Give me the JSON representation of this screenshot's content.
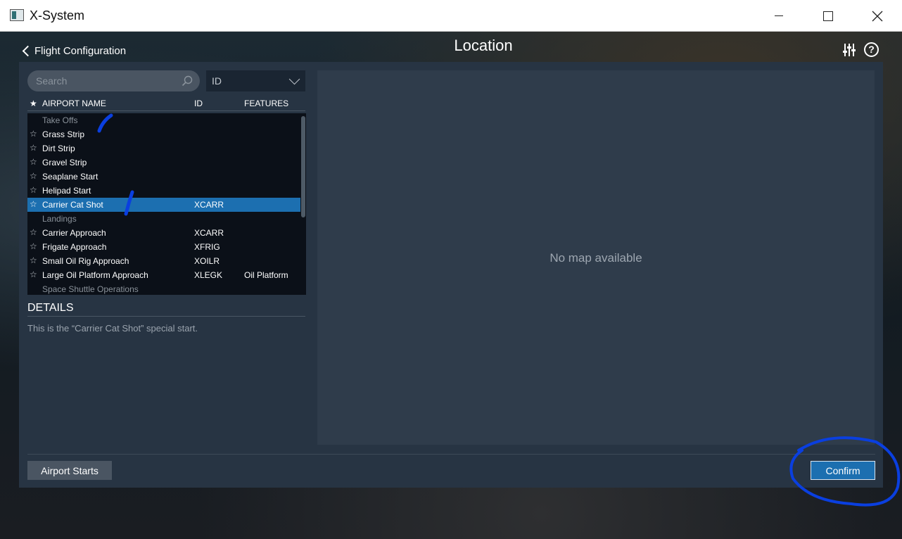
{
  "window": {
    "title": "X-System"
  },
  "header": {
    "back_label": "Flight Configuration",
    "title": "Location",
    "help_glyph": "?"
  },
  "search": {
    "placeholder": "Search",
    "filter_value": "ID"
  },
  "table": {
    "columns": {
      "name": "AIRPORT NAME",
      "id": "ID",
      "features": "FEATURES"
    },
    "rows": [
      {
        "type": "group",
        "name": "Take Offs",
        "id": "",
        "features": ""
      },
      {
        "type": "item",
        "name": "Grass Strip",
        "id": "",
        "features": ""
      },
      {
        "type": "item",
        "name": "Dirt Strip",
        "id": "",
        "features": ""
      },
      {
        "type": "item",
        "name": "Gravel Strip",
        "id": "",
        "features": ""
      },
      {
        "type": "item",
        "name": "Seaplane Start",
        "id": "",
        "features": ""
      },
      {
        "type": "item",
        "name": "Helipad Start",
        "id": "",
        "features": ""
      },
      {
        "type": "item",
        "name": "Carrier Cat Shot",
        "id": "XCARR",
        "features": "",
        "selected": true
      },
      {
        "type": "group",
        "name": "Landings",
        "id": "",
        "features": ""
      },
      {
        "type": "item",
        "name": "Carrier Approach",
        "id": "XCARR",
        "features": ""
      },
      {
        "type": "item",
        "name": "Frigate Approach",
        "id": "XFRIG",
        "features": ""
      },
      {
        "type": "item",
        "name": "Small Oil Rig Approach",
        "id": "XOILR",
        "features": ""
      },
      {
        "type": "item",
        "name": "Large Oil Platform Approach",
        "id": "XLEGK",
        "features": "Oil Platform"
      },
      {
        "type": "group",
        "name": "Space Shuttle Operations",
        "id": "",
        "features": ""
      }
    ]
  },
  "details": {
    "title": "DETAILS",
    "text": "This is the “Carrier Cat Shot” special start."
  },
  "map": {
    "empty_text": "No map available"
  },
  "footer": {
    "airport_starts_label": "Airport Starts",
    "confirm_label": "Confirm"
  },
  "colors": {
    "accent": "#1c6fb0",
    "panel": "#273443",
    "annotation": "#0a3fe0"
  }
}
